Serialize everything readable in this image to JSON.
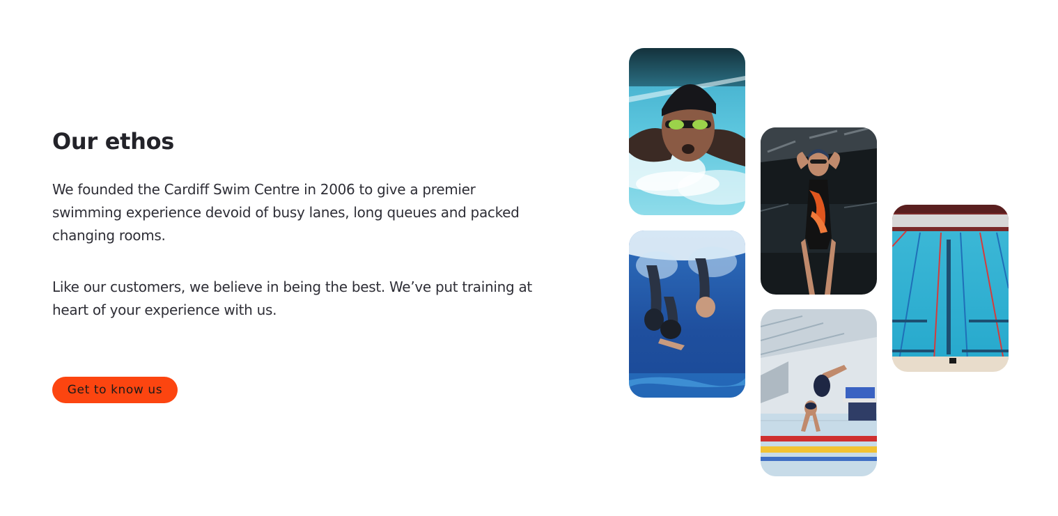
{
  "ethos": {
    "title": "Our ethos",
    "paragraph_1": "We founded the Cardiff Swim Centre in 2006 to give a premier swimming experience devoid of busy lanes, long queues and packed changing rooms.",
    "paragraph_2": "Like our customers, we believe in being the best. We’ve put training at heart of your experience with us.",
    "cta_label": "Get to know us"
  },
  "colors": {
    "accent": "#fc4510",
    "heading": "#232329",
    "body_text": "#2e2e36",
    "background": "#ffffff"
  },
  "gallery": [
    {
      "id": "butterfly",
      "depicts": "swimmer doing butterfly stroke in pool"
    },
    {
      "id": "underwater",
      "depicts": "swimmers diving underwater"
    },
    {
      "id": "swimmer-standing",
      "depicts": "swimmer in swimsuit adjusting goggles"
    },
    {
      "id": "diver",
      "depicts": "swimmer diving into pool from block"
    },
    {
      "id": "pool-lanes",
      "depicts": "empty indoor pool lanes"
    }
  ]
}
